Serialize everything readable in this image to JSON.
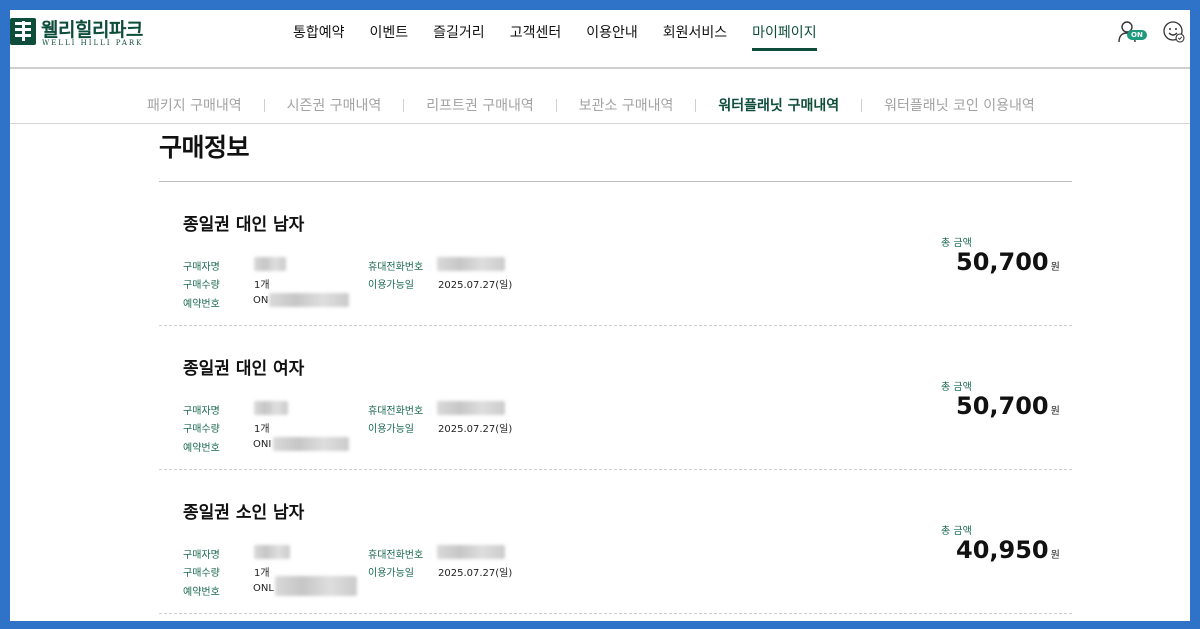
{
  "brand": {
    "name_ko": "웰리힐리파크",
    "name_en": "WELLI HILLI PARK"
  },
  "gnb": {
    "items": [
      "통합예약",
      "이벤트",
      "즐길거리",
      "고객센터",
      "이용안내",
      "회원서비스",
      "마이페이지"
    ],
    "active_index": 6
  },
  "header": {
    "login_badge": "ON"
  },
  "subnav": {
    "items": [
      "패키지 구매내역",
      "시즌권 구매내역",
      "리프트권 구매내역",
      "보관소 구매내역",
      "워터플래닛 구매내역",
      "워터플래닛 코인 이용내역"
    ],
    "active_index": 4
  },
  "page": {
    "title": "구매정보"
  },
  "labels": {
    "buyer": "구매자명",
    "quantity": "구매수량",
    "reservation": "예약번호",
    "phone": "휴대전화번호",
    "usable_date": "이용가능일",
    "total": "총 금액",
    "currency": "원"
  },
  "orders": [
    {
      "product": "종일권 대인 남자",
      "quantity": "1개",
      "reservation_prefix": "ON",
      "usable_date": "2025.07.27(일)",
      "total": "50,700"
    },
    {
      "product": "종일권 대인 여자",
      "quantity": "1개",
      "reservation_prefix": "ONI",
      "usable_date": "2025.07.27(일)",
      "total": "50,700"
    },
    {
      "product": "종일권 소인 남자",
      "quantity": "1개",
      "reservation_prefix": "ONL",
      "usable_date": "2025.07.27(일)",
      "total": "40,950"
    }
  ],
  "colors": {
    "brand_green": "#0e4d3a",
    "label_green": "#1b6b50",
    "frame_blue": "#2f73c8",
    "badge_green": "#1e9b7f"
  }
}
